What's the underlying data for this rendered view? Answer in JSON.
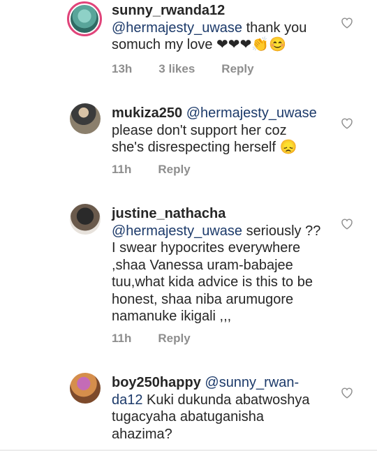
{
  "comments": [
    {
      "username": "sunny_rwanda12",
      "mention": "@hermajesty_uwase",
      "body": " thank you somuch my love ❤❤❤👏😊",
      "time": "13h",
      "likes": "3 likes",
      "reply": "Reply"
    },
    {
      "username": "mukiza250",
      "mention": " @hermajesty_uwase",
      "body": " please don't support her coz she's disrespecting herself 😞",
      "time": "11h",
      "likes": "",
      "reply": "Reply"
    },
    {
      "username": "justine_nathacha",
      "mention": "@hermajesty_uwase",
      "body": " seriously ?? I swear hypocrites everywhere ,shaa Vanessa uram-babajee tuu,what kida advice is this to be honest, shaa niba arumugore namanuke ikigali ,,,",
      "time": "11h",
      "likes": "",
      "reply": "Reply"
    },
    {
      "username": "boy250happy",
      "mention": " @sunny_rwan-da12",
      "body": " Kuki dukunda abatwoshya tugacyaha abatuganisha ahazima?",
      "time": "",
      "likes": "",
      "reply": ""
    }
  ],
  "icons": {
    "like": "heart-outline-icon",
    "avatar": "avatar"
  },
  "colors": {
    "mention": "#1c3a6a",
    "meta": "#8e8e8e",
    "ring": "#e0447a"
  }
}
